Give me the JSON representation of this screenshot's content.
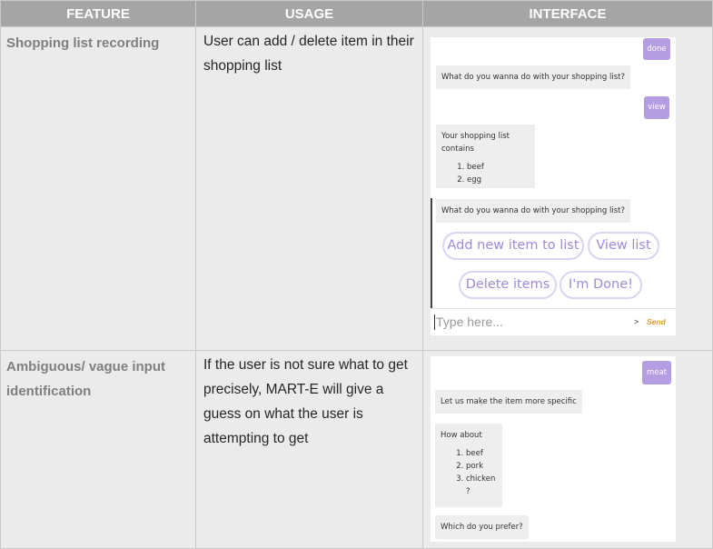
{
  "headers": {
    "feature": "FEATURE",
    "usage": "USAGE",
    "interface": "INTERFACE"
  },
  "rows": [
    {
      "feature": "Shopping list recording",
      "usage": "User can add / delete item in their shopping list",
      "chat": {
        "user_msg_1": "done",
        "bot_msg_1": "What do you wanna do with your shopping list?",
        "user_msg_2": "view",
        "bot_list_title": "Your shopping list contains",
        "bot_list_items": [
          "beef",
          "egg"
        ],
        "bot_msg_2": "What do you wanna do with your shopping list?",
        "options": [
          "Add new item to list",
          "View list",
          "Delete items",
          "I'm Done!"
        ],
        "input_placeholder": "Type here...",
        "send_label": "Send",
        "send_arrow": ">"
      }
    },
    {
      "feature": "Ambiguous/ vague input identification",
      "usage": "If the user is not sure what to get precisely, MART-E will give a guess on what the user is attempting to get",
      "chat": {
        "user_msg_1": "meat",
        "bot_msg_1": "Let us make the item more specific",
        "bot_list_title": "How about",
        "bot_list_items": [
          "beef",
          "pork",
          "chicken ?"
        ],
        "bot_msg_2": "Which do you prefer?"
      }
    }
  ],
  "colors": {
    "header_bg": "#a5a5a5",
    "row_bg": "#ebebeb",
    "user_bubble": "#b59de2",
    "option_text": "#a08ad8",
    "send": "#e89a2c"
  }
}
